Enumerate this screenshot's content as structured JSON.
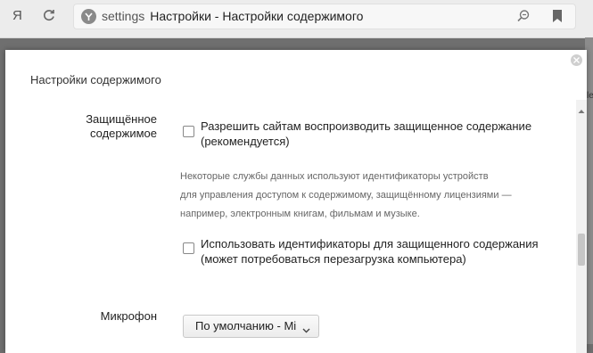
{
  "browser": {
    "logo": "Я",
    "address": {
      "site": "settings",
      "title": "Настройки - Настройки содержимого"
    }
  },
  "background_page": {
    "side_text": "le"
  },
  "dialog": {
    "title": "Настройки содержимого",
    "protected_content": {
      "label_line1": "Защищённое",
      "label_line2": "содержимое",
      "option1": {
        "line1": "Разрешить сайтам воспроизводить защищенное содержание",
        "line2": "(рекомендуется)",
        "checked": false
      },
      "note_lines": [
        "Некоторые службы данных используют идентификаторы устройств",
        "для управления доступом к содержимому, защищённому лицензиями —",
        "например, электронным книгам, фильмам и музыке."
      ],
      "option2": {
        "line1": "Использовать идентификаторы для защищенного содержания",
        "line2": "(может потребоваться перезагрузка компьютера)",
        "checked": false
      }
    },
    "microphone": {
      "label": "Микрофон",
      "selected": "По умолчанию - Mi"
    }
  },
  "icons": {
    "reload": "reload-icon",
    "site_badge": "yandex-badge-icon",
    "search": "search-icon",
    "bookmark": "bookmark-icon",
    "close": "close-icon",
    "chevron": "chevron-down-icon"
  }
}
